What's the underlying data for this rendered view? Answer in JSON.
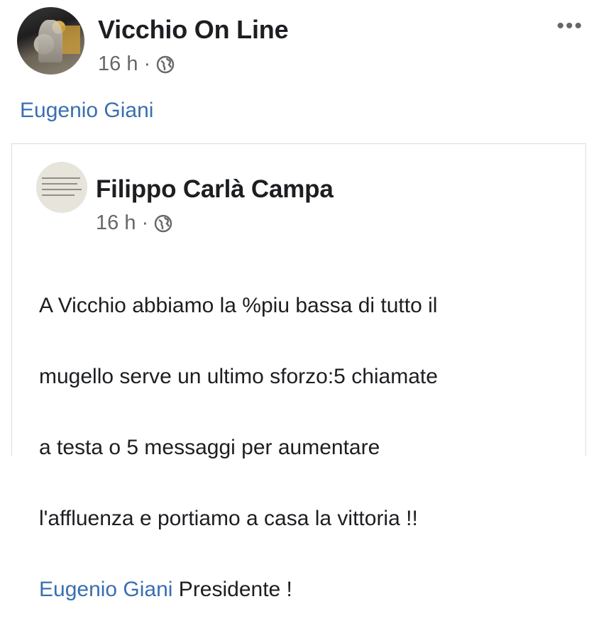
{
  "post": {
    "page_name": "Vicchio On Line",
    "time": "16 h",
    "separator": "·",
    "privacy_icon": "globe-icon",
    "more_label": "•••",
    "mention": "Eugenio Giani"
  },
  "shared_post": {
    "author": "Filippo Carlà Campa",
    "time": "16 h",
    "separator": "·",
    "privacy_icon": "globe-icon",
    "text_lines": [
      "A Vicchio abbiamo la %piu bassa di tutto il",
      "mugello serve un ultimo sforzo:5 chiamate",
      "a testa o 5 messaggi per aumentare",
      "l'affluenza  e portiamo a casa la vittoria !!"
    ],
    "mention": "Eugenio Giani",
    "text_suffix": " Presidente !"
  },
  "colors": {
    "link": "#3a6fb0",
    "secondary_text": "#65676b",
    "primary_text": "#1c1e21",
    "border": "#dadde1"
  }
}
